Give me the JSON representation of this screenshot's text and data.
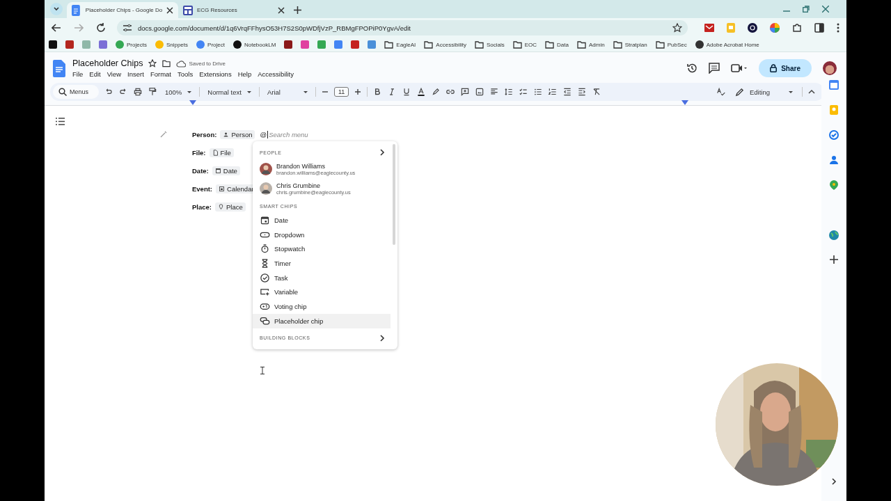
{
  "browser": {
    "tabs": [
      {
        "title": "Placeholder Chips - Google Do",
        "selected": true,
        "kind": "docs"
      },
      {
        "title": "ECG Resources",
        "selected": false,
        "kind": "sites"
      }
    ],
    "url": "docs.google.com/document/d/1q6VrqFFhysO53H7S2S0pWDfjVzP_RBMgFPOPiP0YgvA/edit",
    "bookmarks": [
      {
        "kind": "icon",
        "color": "#111111"
      },
      {
        "kind": "icon",
        "color": "#b3261e"
      },
      {
        "kind": "icon",
        "color": "#8fb8a8"
      },
      {
        "kind": "icon",
        "color": "#7b6fd6"
      },
      {
        "kind": "app",
        "label": "Projects",
        "color": "#34a853"
      },
      {
        "kind": "app",
        "label": "Snippets",
        "color": "#fbbc04"
      },
      {
        "kind": "app",
        "label": "Project",
        "color": "#4285f4"
      },
      {
        "kind": "app",
        "label": "NotebookLM",
        "color": "#111111"
      },
      {
        "kind": "icon",
        "color": "#8b1a1a"
      },
      {
        "kind": "icon",
        "color": "#e040a0"
      },
      {
        "kind": "icon",
        "color": "#34a853"
      },
      {
        "kind": "icon",
        "color": "#4285f4"
      },
      {
        "kind": "icon",
        "color": "#c5221f"
      },
      {
        "kind": "icon",
        "color": "#4a90d9"
      },
      {
        "kind": "folder",
        "label": "EagleAI"
      },
      {
        "kind": "folder",
        "label": "Accessibility"
      },
      {
        "kind": "folder",
        "label": "Socials"
      },
      {
        "kind": "folder",
        "label": "EOC"
      },
      {
        "kind": "folder",
        "label": "Data"
      },
      {
        "kind": "folder",
        "label": "Admin"
      },
      {
        "kind": "folder",
        "label": "Stratplan"
      },
      {
        "kind": "folder",
        "label": "PubSec"
      },
      {
        "kind": "app",
        "label": "Adobe Acrobat Home",
        "color": "#333333"
      }
    ]
  },
  "doc": {
    "title": "Placeholder Chips",
    "save_status": "Saved to Drive",
    "menus": [
      "File",
      "Edit",
      "View",
      "Insert",
      "Format",
      "Tools",
      "Extensions",
      "Help",
      "Accessibility"
    ],
    "share": "Share",
    "toolbar": {
      "search_placeholder": "Menus",
      "zoom": "100%",
      "style": "Normal text",
      "font": "Arial",
      "font_size": "11",
      "mode": "Editing"
    },
    "fields": [
      {
        "label": "Person:",
        "chip": "Person",
        "kind": "person"
      },
      {
        "label": "File:",
        "chip": "File",
        "kind": "file"
      },
      {
        "label": "Date:",
        "chip": "Date",
        "kind": "date"
      },
      {
        "label": "Event:",
        "chip": "Calendar",
        "kind": "event"
      },
      {
        "label": "Place:",
        "chip": "Place",
        "kind": "place"
      }
    ],
    "at_sign": "@",
    "search_placeholder": "Search menu"
  },
  "menu": {
    "people_header": "PEOPLE",
    "people": [
      {
        "name": "Brandon Williams",
        "email": "brandon.williams@eaglecounty.us",
        "color": "#a0524a"
      },
      {
        "name": "Chris Grumbine",
        "email": "chris.grumbine@eaglecounty.us",
        "color": "#b8b0a8"
      }
    ],
    "chips_header": "SMART CHIPS",
    "items": [
      {
        "label": "Date",
        "kind": "date",
        "selected": false
      },
      {
        "label": "Dropdown",
        "kind": "dropdown",
        "selected": false
      },
      {
        "label": "Stopwatch",
        "kind": "stopwatch",
        "selected": false
      },
      {
        "label": "Timer",
        "kind": "timer",
        "selected": false
      },
      {
        "label": "Task",
        "kind": "task",
        "selected": false
      },
      {
        "label": "Variable",
        "kind": "variable",
        "selected": false
      },
      {
        "label": "Voting chip",
        "kind": "voting",
        "selected": false
      },
      {
        "label": "Placeholder chip",
        "kind": "placeholder",
        "selected": true
      }
    ],
    "blocks_header": "BUILDING BLOCKS"
  }
}
